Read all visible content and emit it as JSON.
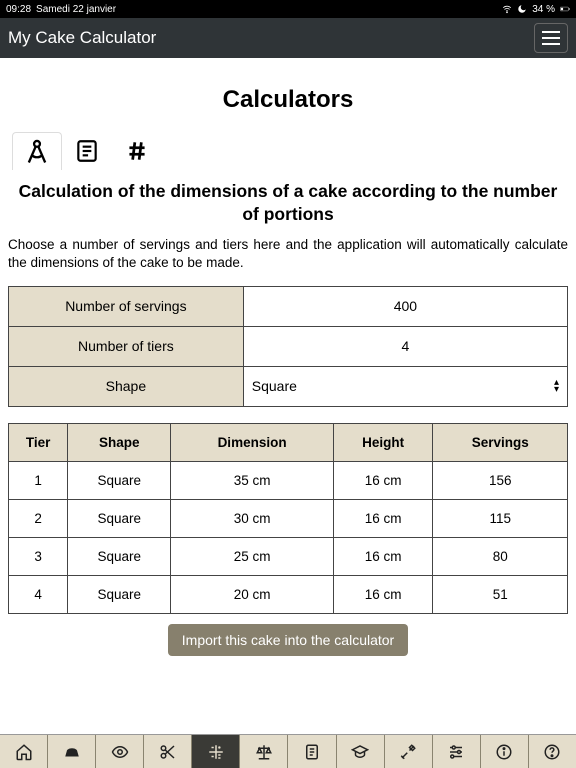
{
  "status": {
    "time": "09:28",
    "date": "Samedi 22 janvier",
    "battery": "34 %"
  },
  "header": {
    "title": "My Cake Calculator"
  },
  "page": {
    "title": "Calculators",
    "section_title": "Calculation of the dimensions of a cake according to the number of portions",
    "section_desc": "Choose a number of servings and tiers here and the application will automatically calculate the dimensions of the cake to be made."
  },
  "params": {
    "servings_label": "Number of servings",
    "servings_value": "400",
    "tiers_label": "Number of tiers",
    "tiers_value": "4",
    "shape_label": "Shape",
    "shape_value": "Square"
  },
  "results": {
    "headers": {
      "tier": "Tier",
      "shape": "Shape",
      "dimension": "Dimension",
      "height": "Height",
      "servings": "Servings"
    },
    "rows": [
      {
        "tier": "1",
        "shape": "Square",
        "dimension": "35 cm",
        "height": "16 cm",
        "servings": "156"
      },
      {
        "tier": "2",
        "shape": "Square",
        "dimension": "30 cm",
        "height": "16 cm",
        "servings": "115"
      },
      {
        "tier": "3",
        "shape": "Square",
        "dimension": "25 cm",
        "height": "16 cm",
        "servings": "80"
      },
      {
        "tier": "4",
        "shape": "Square",
        "dimension": "20 cm",
        "height": "16 cm",
        "servings": "51"
      }
    ]
  },
  "actions": {
    "import_label": "Import this cake into the calculator"
  }
}
